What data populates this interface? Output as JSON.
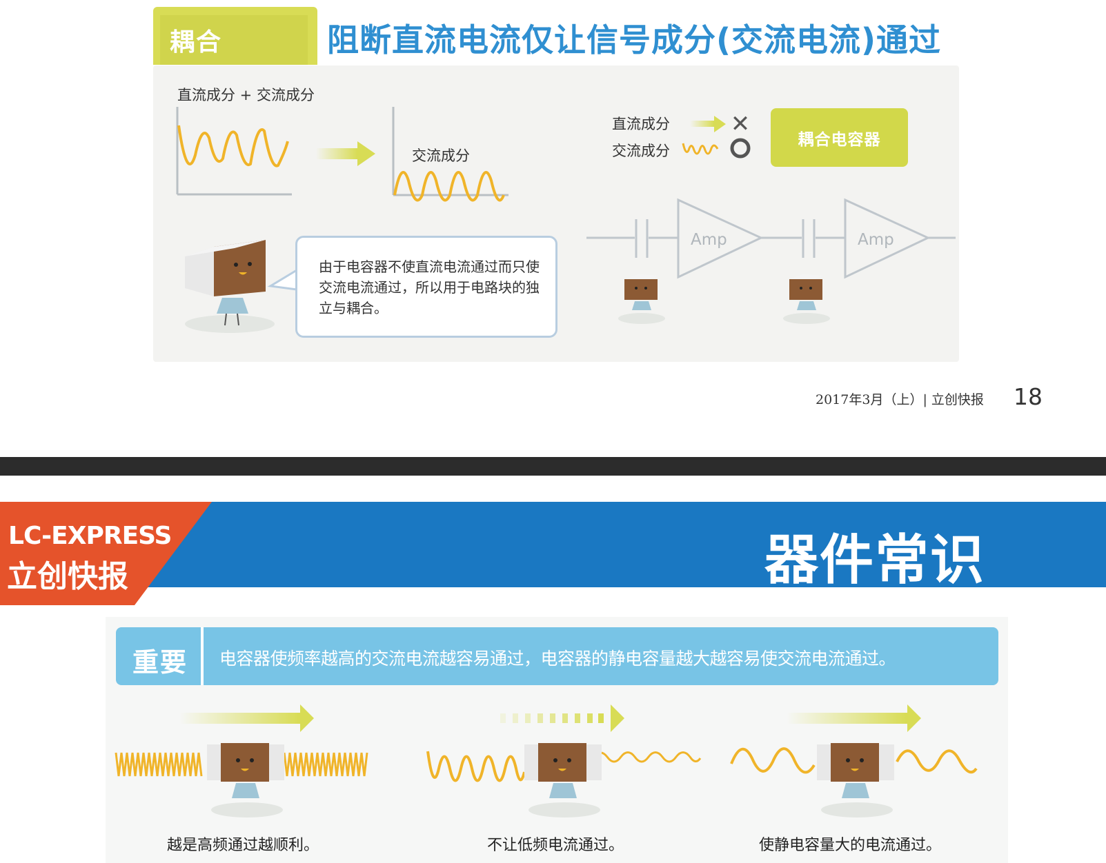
{
  "top_page": {
    "tab_label": "耦合",
    "title": "阻断直流电流仅让信号成分(交流电流)通过",
    "dc_plus_ac_label": "直流成分 + 交流成分",
    "ac_label": "交流成分",
    "dc_component_label": "直流成分",
    "ac_component_label": "交流成分",
    "cross_mark": "✕",
    "circle_mark": "○",
    "coupling_capacitor_label": "耦合电容器",
    "speech_text": "由于电容器不使直流电流通过而只使交流电流通过，所以用于电路块的独立与耦合。",
    "amp_label_1": "Amp",
    "amp_label_2": "Amp",
    "footer": "2017年3月（上）| 立创快报",
    "page_number": "18"
  },
  "bottom_page": {
    "brand_en": "LC-EXPRESS",
    "brand_cn": "立创快报",
    "section_title": "器件常识",
    "important_label": "重要",
    "important_text": "电容器使频率越高的交流电流越容易通过，电容器的静电容量越大越容易使交流电流通过。",
    "captions": [
      "越是高频通过越顺利。",
      "不让低频电流通过。",
      "使静电容量大的电流通过。"
    ]
  },
  "colors": {
    "title_blue": "#2f8fd1",
    "tab_green": "#d8dc55",
    "wave_orange": "#f0b429",
    "header_blue": "#1a78c2",
    "brand_orange": "#e5532b",
    "important_blue": "#78c4e6"
  }
}
